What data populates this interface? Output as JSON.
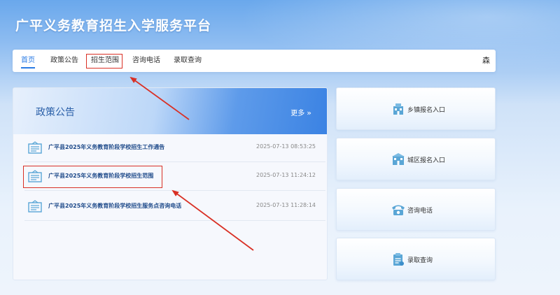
{
  "site": {
    "title": "广平义务教育招生入学服务平台"
  },
  "nav": {
    "items": [
      {
        "label": "首页",
        "active": true
      },
      {
        "label": "政策公告",
        "active": false
      },
      {
        "label": "招生范围",
        "active": false,
        "highlighted": true
      },
      {
        "label": "咨询电话",
        "active": false
      },
      {
        "label": "录取查询",
        "active": false
      }
    ],
    "user": "森"
  },
  "policy": {
    "title": "政策公告",
    "more_label": "更多",
    "items": [
      {
        "title": "广平县2025年义务教育阶段学校招生工作通告",
        "date": "2025-07-13 08:53:25"
      },
      {
        "title": "广平县2025年义务教育阶段学校招生范围",
        "date": "2025-07-13 11:24:12",
        "highlighted": true
      },
      {
        "title": "广平县2025年义务教育阶段学校招生服务点咨询电话",
        "date": "2025-07-13 11:28:14"
      }
    ]
  },
  "entries": [
    {
      "label": "乡镇报名入口",
      "icon": "town-building-icon"
    },
    {
      "label": "城区报名入口",
      "icon": "city-building-icon"
    },
    {
      "label": "咨询电话",
      "icon": "telephone-icon"
    },
    {
      "label": "录取查询",
      "icon": "clipboard-icon"
    }
  ],
  "colors": {
    "accent": "#2a7be4",
    "annotation_red": "#d93025",
    "row_title": "#1e4a8a",
    "icon_teal": "#5aa6d6"
  }
}
